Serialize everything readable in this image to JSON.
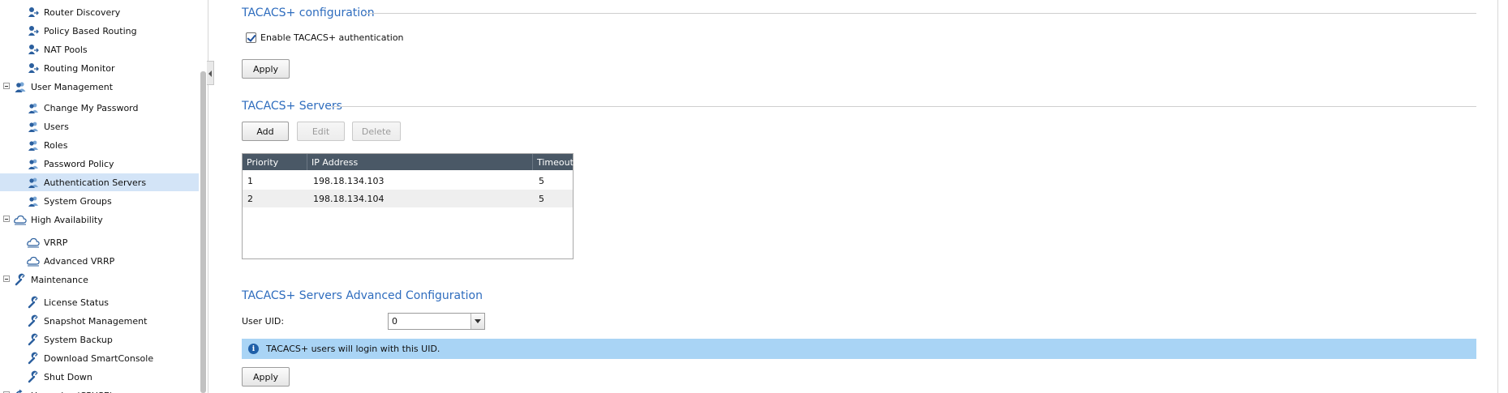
{
  "sidebar": {
    "items": [
      {
        "label": "Router Discovery",
        "kind": "child",
        "icon": "routing-icon",
        "selected": false
      },
      {
        "label": "Policy Based Routing",
        "kind": "child",
        "icon": "routing-icon",
        "selected": false
      },
      {
        "label": "NAT Pools",
        "kind": "child",
        "icon": "routing-icon",
        "selected": false
      },
      {
        "label": "Routing Monitor",
        "kind": "child",
        "icon": "routing-icon",
        "selected": false
      },
      {
        "label": "User Management",
        "kind": "group",
        "icon": "users-icon",
        "selected": false
      },
      {
        "label": "Change My Password",
        "kind": "child",
        "icon": "user-icon",
        "selected": false
      },
      {
        "label": "Users",
        "kind": "child",
        "icon": "user-icon",
        "selected": false
      },
      {
        "label": "Roles",
        "kind": "child",
        "icon": "user-icon",
        "selected": false
      },
      {
        "label": "Password Policy",
        "kind": "child",
        "icon": "user-icon",
        "selected": false
      },
      {
        "label": "Authentication Servers",
        "kind": "child",
        "icon": "user-icon",
        "selected": true
      },
      {
        "label": "System Groups",
        "kind": "child",
        "icon": "user-icon",
        "selected": false
      },
      {
        "label": "High Availability",
        "kind": "group",
        "icon": "cloud-icon",
        "selected": false
      },
      {
        "label": "VRRP",
        "kind": "child",
        "icon": "cloud-icon",
        "selected": false
      },
      {
        "label": "Advanced VRRP",
        "kind": "child",
        "icon": "cloud-icon",
        "selected": false
      },
      {
        "label": "Maintenance",
        "kind": "group",
        "icon": "wrench-icon",
        "selected": false
      },
      {
        "label": "License Status",
        "kind": "child",
        "icon": "wrench-icon",
        "selected": false
      },
      {
        "label": "Snapshot Management",
        "kind": "child",
        "icon": "wrench-icon",
        "selected": false
      },
      {
        "label": "System Backup",
        "kind": "child",
        "icon": "wrench-icon",
        "selected": false
      },
      {
        "label": "Download SmartConsole",
        "kind": "child",
        "icon": "wrench-icon",
        "selected": false
      },
      {
        "label": "Shut Down",
        "kind": "child",
        "icon": "wrench-icon",
        "selected": false
      },
      {
        "label": "Upgrades (CPUSE)",
        "kind": "group",
        "icon": "refresh-icon",
        "selected": false
      }
    ]
  },
  "tacacs_config": {
    "title": "TACACS+ configuration",
    "enable_label": "Enable TACACS+ authentication",
    "enable_checked": true,
    "apply_label": "Apply"
  },
  "servers": {
    "title": "TACACS+ Servers",
    "add_label": "Add",
    "edit_label": "Edit",
    "delete_label": "Delete",
    "columns": [
      "Priority",
      "IP Address",
      "Timeout"
    ],
    "rows": [
      [
        "1",
        "198.18.134.103",
        "5"
      ],
      [
        "2",
        "198.18.134.104",
        "5"
      ]
    ]
  },
  "advanced": {
    "title": "TACACS+ Servers Advanced Configuration",
    "uid_label": "User UID:",
    "uid_value": "0",
    "info_text": "TACACS+ users will login with this UID.",
    "apply_label": "Apply"
  },
  "colors": {
    "accent": "#2f6dbe",
    "selected_row": "#d3e4f7",
    "grid_header": "#4a5866",
    "info_bar": "#a9d4f5"
  }
}
